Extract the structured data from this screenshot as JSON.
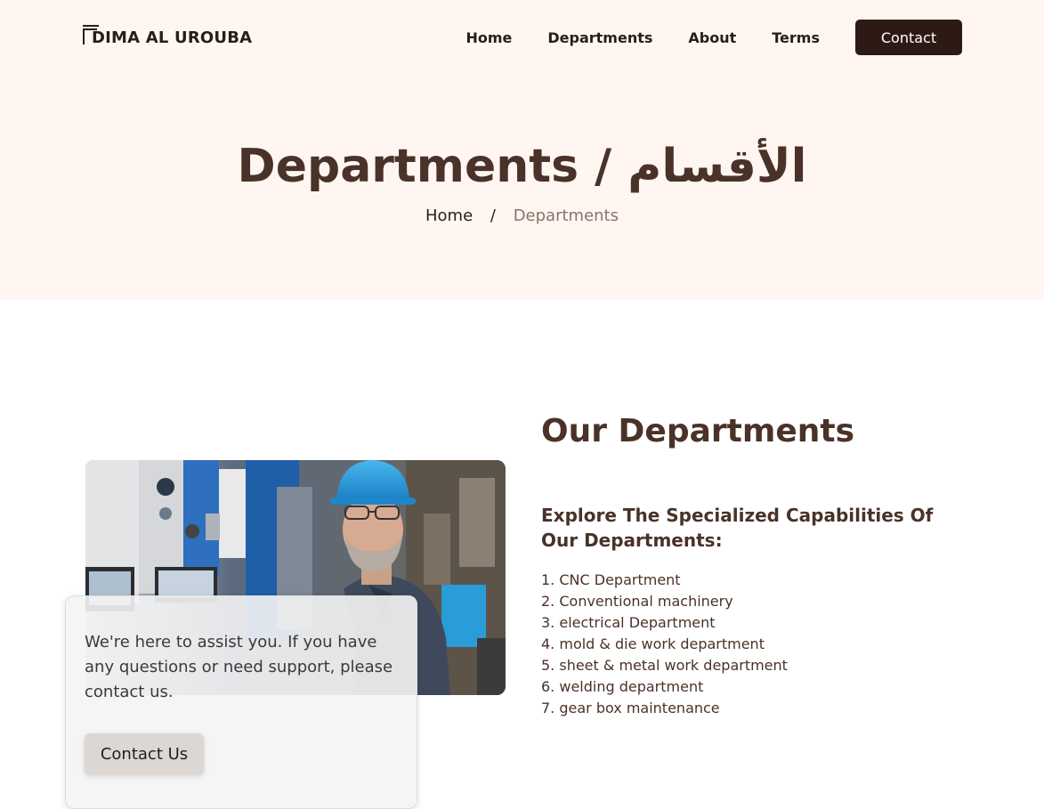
{
  "brand": {
    "name": "DIMA AL UROUBA"
  },
  "nav": {
    "items": [
      {
        "label": "Home"
      },
      {
        "label": "Departments"
      },
      {
        "label": "About"
      },
      {
        "label": "Terms"
      }
    ],
    "contact_label": "Contact"
  },
  "hero": {
    "title": "Departments / الأقسام",
    "breadcrumb": {
      "home": "Home",
      "separator": "/",
      "current": "Departments"
    }
  },
  "departments": {
    "title": "Our Departments",
    "subtitle": "Explore The Specialized Capabilities Of Our Departments:",
    "items": [
      "1. CNC Department",
      "2. Conventional machinery",
      "3. electrical Department",
      "4. mold & die work department",
      "5. sheet & metal work department",
      "6. welding department",
      "7. gear box maintenance"
    ]
  },
  "assist_card": {
    "text": "We're here to assist you. If you have any questions or need support, please contact us.",
    "button_label": "Contact Us"
  },
  "colors": {
    "hero_background": "#fff6f2",
    "heading": "#4a3228",
    "nav_button": "#2e1a14",
    "breadcrumb_current": "#8a7466"
  }
}
